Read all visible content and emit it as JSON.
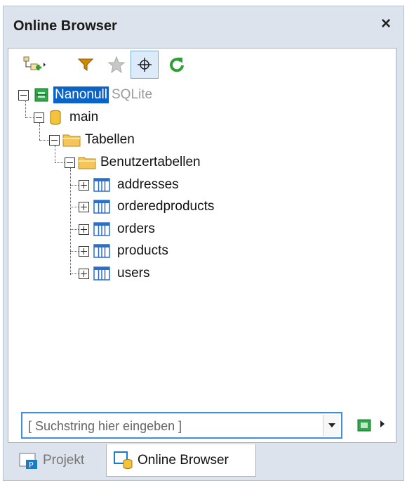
{
  "window": {
    "title": "Online Browser",
    "close_label": "×"
  },
  "toolbar": {
    "buttons": [
      {
        "name": "add-datasource-button",
        "icon": "add-connection-icon"
      },
      {
        "name": "filter-button",
        "icon": "filter-icon"
      },
      {
        "name": "favorites-button",
        "icon": "star-icon"
      },
      {
        "name": "locate-button",
        "icon": "crosshair-icon",
        "selected": true
      },
      {
        "name": "refresh-button",
        "icon": "refresh-icon"
      }
    ]
  },
  "tree": {
    "root": {
      "label": "Nanonull",
      "suffix": "SQLite"
    },
    "schema": "main",
    "folder": "Tabellen",
    "subfolder": "Benutzertabellen",
    "tables": [
      "addresses",
      "orderedproducts",
      "orders",
      "products",
      "users"
    ]
  },
  "search": {
    "placeholder": "[ Suchstring hier eingeben ]",
    "value": ""
  },
  "tabs": [
    {
      "label": "Projekt",
      "active": false
    },
    {
      "label": "Online Browser",
      "active": true
    }
  ],
  "colors": {
    "accent": "#0a63c9",
    "frame": "#dde3ec",
    "folder": "#f3c04a",
    "table_icon": "#2a6fc9",
    "refresh": "#2f9e34",
    "filter": "#c98a00"
  }
}
